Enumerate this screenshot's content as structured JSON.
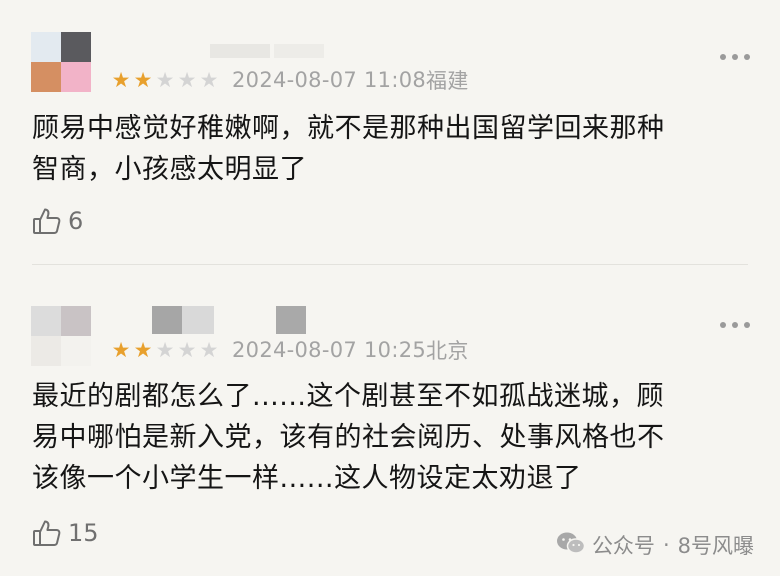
{
  "reviews": [
    {
      "rating": 2,
      "max_rating": 5,
      "date": "2024-08-07 11:08",
      "location": "福建",
      "content": "顾易中感觉好稚嫩啊，就不是那种出国留学回来那种\n智商，小孩感太明显了",
      "likes": "6"
    },
    {
      "rating": 2,
      "max_rating": 5,
      "date": "2024-08-07 10:25",
      "location": "北京",
      "content": "最近的剧都怎么了......这个剧甚至不如孤战迷城，顾\n易中哪怕是新入党，该有的社会阅历、处事风格也不\n该像一个小学生一样......这人物设定太劝退了",
      "likes": "15"
    }
  ],
  "watermark": {
    "label": "公众号",
    "separator": "·",
    "account": "8号风曝"
  },
  "icons": {
    "more": "more-dots-icon",
    "like": "thumbs-up-icon",
    "star": "star-icon",
    "wechat": "wechat-icon"
  },
  "colors": {
    "background": "#f6f5f1",
    "star_filled": "#e8a02d",
    "star_empty": "#d4d4d4",
    "meta_text": "#a3a3a3"
  }
}
